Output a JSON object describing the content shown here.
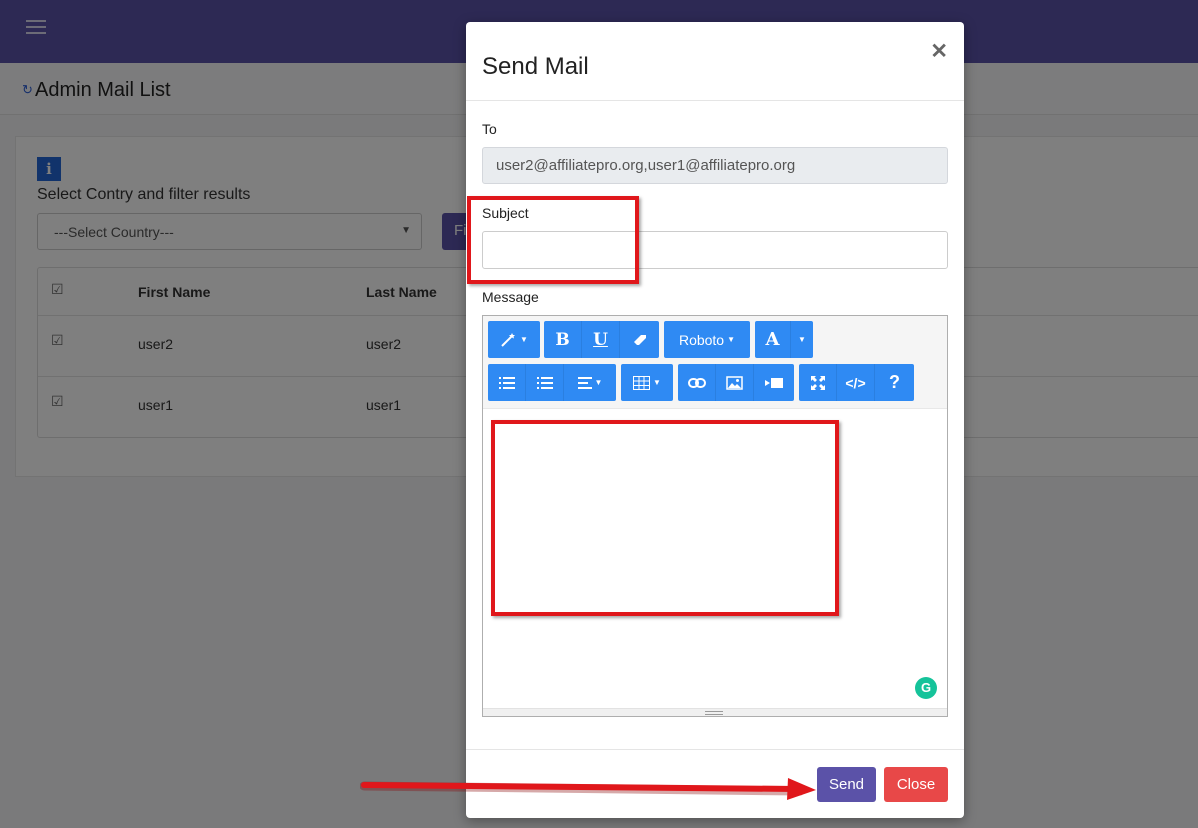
{
  "page": {
    "title": "Admin Mail List",
    "filter_label": "Select Contry and filter results",
    "country_select_value": "---Select Country---",
    "filter_button_label": "Filter",
    "table": {
      "headers": [
        "First Name",
        "Last Name"
      ],
      "rows": [
        {
          "first_name": "user2",
          "last_name": "user2"
        },
        {
          "first_name": "user1",
          "last_name": "user1"
        }
      ]
    }
  },
  "modal": {
    "title": "Send Mail",
    "to_label": "To",
    "to_value": "user2@affiliatepro.org,user1@affiliatepro.org",
    "subject_label": "Subject",
    "subject_value": "",
    "message_label": "Message",
    "toolbar": {
      "font_family": "Roboto",
      "bold": "B",
      "underline": "U",
      "font_color": "A",
      "codeview": "</>",
      "help": "?"
    },
    "send_label": "Send",
    "close_label": "Close"
  },
  "colors": {
    "brand": "#5b52a8",
    "danger": "#e84848",
    "editor_button": "#2f8af3",
    "annotation": "#e0171b"
  }
}
